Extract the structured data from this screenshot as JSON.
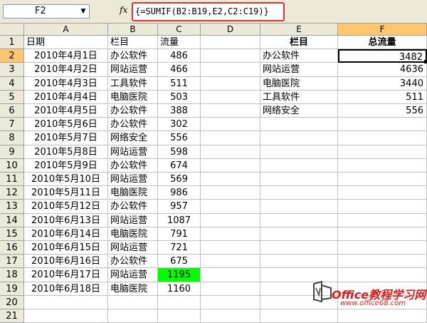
{
  "formula_bar": {
    "name_box": "F2",
    "fx_label": "fx",
    "formula": "{=SUMIF(B2:B19,E2,C2:C19)}"
  },
  "columns": [
    "A",
    "B",
    "C",
    "D",
    "E",
    "F"
  ],
  "rows": [
    {
      "num": "1",
      "a": "日期",
      "b": "栏目",
      "c": "流量",
      "e": "栏目",
      "f": "总流量"
    },
    {
      "num": "2",
      "a": "2010年4月1日",
      "b": "办公软件",
      "c": "486",
      "e": "办公软件",
      "f": "3482"
    },
    {
      "num": "3",
      "a": "2010年4月2日",
      "b": "网站运营",
      "c": "466",
      "e": "网站运营",
      "f": "4636"
    },
    {
      "num": "4",
      "a": "2010年4月3日",
      "b": "工具软件",
      "c": "511",
      "e": "电脑医院",
      "f": "3440"
    },
    {
      "num": "5",
      "a": "2010年4月4日",
      "b": "电脑医院",
      "c": "503",
      "e": "工具软件",
      "f": "511"
    },
    {
      "num": "6",
      "a": "2010年4月5日",
      "b": "办公软件",
      "c": "388",
      "e": "网络安全",
      "f": "556"
    },
    {
      "num": "7",
      "a": "2010年5月6日",
      "b": "办公软件",
      "c": "302"
    },
    {
      "num": "8",
      "a": "2010年5月7日",
      "b": "网络安全",
      "c": "556"
    },
    {
      "num": "9",
      "a": "2010年5月8日",
      "b": "网站运营",
      "c": "598"
    },
    {
      "num": "10",
      "a": "2010年5月9日",
      "b": "办公软件",
      "c": "674"
    },
    {
      "num": "11",
      "a": "2010年5月10日",
      "b": "网站运营",
      "c": "569"
    },
    {
      "num": "12",
      "a": "2010年5月11日",
      "b": "电脑医院",
      "c": "986"
    },
    {
      "num": "13",
      "a": "2010年5月12日",
      "b": "办公软件",
      "c": "957"
    },
    {
      "num": "14",
      "a": "2010年6月13日",
      "b": "网站运营",
      "c": "1087"
    },
    {
      "num": "15",
      "a": "2010年6月14日",
      "b": "电脑医院",
      "c": "791"
    },
    {
      "num": "16",
      "a": "2010年6月15日",
      "b": "网站运营",
      "c": "721"
    },
    {
      "num": "17",
      "a": "2010年6月16日",
      "b": "办公软件",
      "c": "675"
    },
    {
      "num": "18",
      "a": "2010年6月17日",
      "b": "网站运营",
      "c": "1195"
    },
    {
      "num": "19",
      "a": "2010年6月18日",
      "b": "电脑医院",
      "c": "1160"
    },
    {
      "num": "20"
    },
    {
      "num": "21"
    }
  ],
  "watermark": {
    "text": "Office教程学习网",
    "url": "www.office68.com"
  },
  "colors": {
    "highlight": "#00ff00",
    "formula_border": "#e03030",
    "selected_header": "#ffc66b"
  }
}
